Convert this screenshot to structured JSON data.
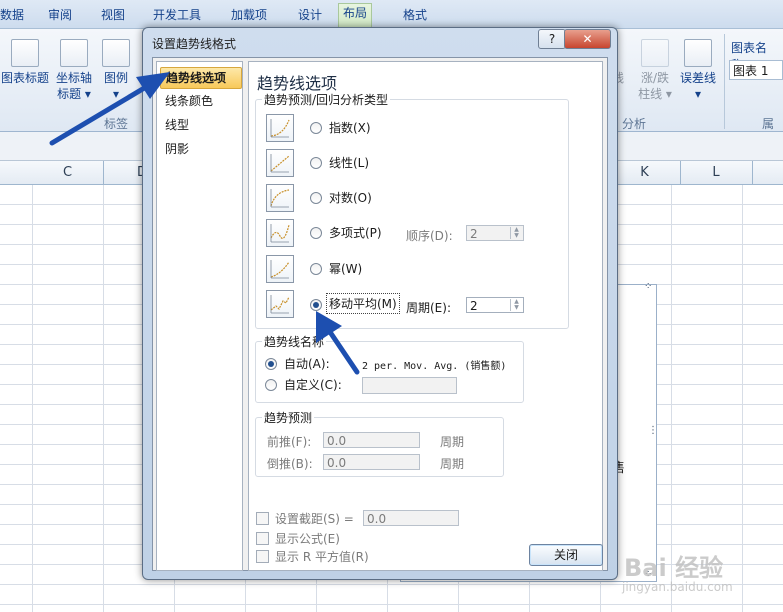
{
  "ribbon": {
    "tabs": [
      "数据",
      "审阅",
      "视图",
      "开发工具",
      "加载项",
      "设计",
      "布局",
      "格式"
    ],
    "left_buttons": [
      {
        "line1": "图表标题",
        "line2": ""
      },
      {
        "line1": "坐标轴",
        "line2": "标题 ▾"
      },
      {
        "line1": "图例",
        "line2": "▾"
      }
    ],
    "left_group_label": "标签",
    "right_buttons": [
      {
        "line1": "线",
        "line2": ""
      },
      {
        "line1": "涨/跌",
        "line2": "柱线 ▾"
      },
      {
        "line1": "误差线",
        "line2": "▾"
      }
    ],
    "right_group_label": "分析",
    "chart_name_label": "图表名称:",
    "chart_name_value": "图表 1",
    "properties_label": "属性"
  },
  "sheet": {
    "columns": [
      "C",
      "D",
      "K",
      "L"
    ],
    "chart_partial_text": "售"
  },
  "dialog": {
    "title": "设置趋势线格式",
    "help": "?",
    "close_x": "✕",
    "nav": [
      "趋势线选项",
      "线条颜色",
      "线型",
      "阴影"
    ],
    "panel_title": "趋势线选项",
    "type_group_label": "趋势预测/回归分析类型",
    "types": [
      "指数(X)",
      "线性(L)",
      "对数(O)",
      "多项式(P)",
      "幂(W)",
      "移动平均(M)"
    ],
    "order_label": "顺序(D):",
    "order_value": "2",
    "period_label": "周期(E):",
    "period_value": "2",
    "name_group_label": "趋势线名称",
    "auto_label": "自动(A):",
    "auto_value": "2 per. Mov. Avg. (销售额)",
    "custom_label": "自定义(C):",
    "custom_value": "",
    "forecast_group_label": "趋势预测",
    "forward_label": "前推(F):",
    "forward_value": "0.0",
    "backward_label": "倒推(B):",
    "backward_value": "0.0",
    "period_unit": "周期",
    "intercept_label": "设置截距(S) =",
    "intercept_value": "0.0",
    "show_equation_label": "显示公式(E)",
    "show_r2_label": "显示 R 平方值(R)",
    "close_button": "关闭"
  },
  "watermark": {
    "text": "Bai 经验",
    "sub": "jingyan.baidu.com"
  }
}
